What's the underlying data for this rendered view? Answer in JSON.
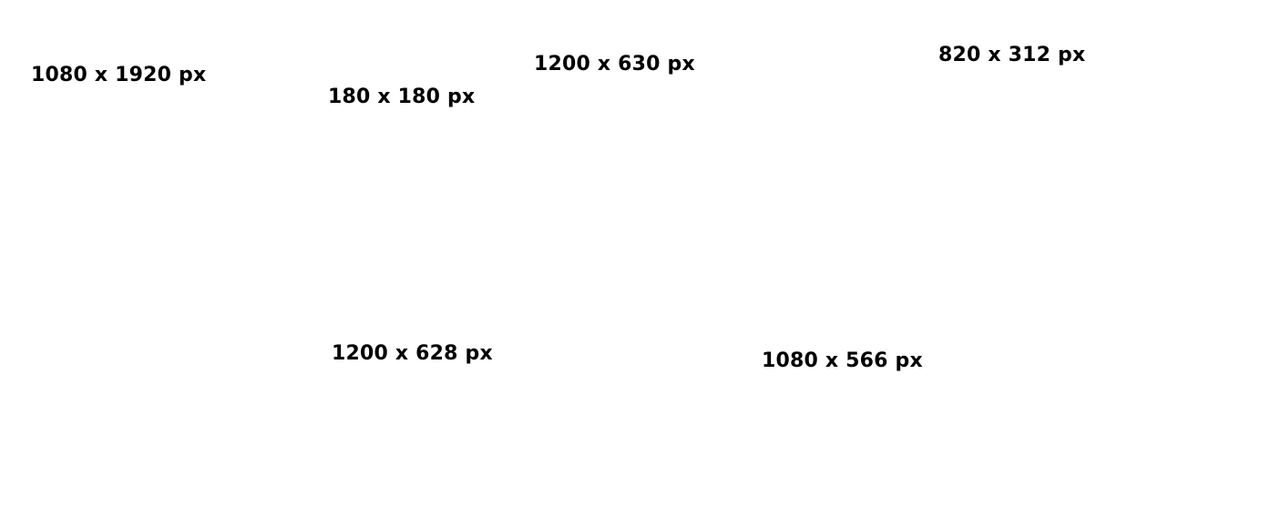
{
  "labels": {
    "story": "1080 x 1920 px",
    "profile": "180 x 180 px",
    "shared_image": "1200 x 630 px",
    "cover": "820 x 312 px",
    "link_image": "1200 x 628 px",
    "ad_image": "1080 x 566 px"
  },
  "colors": {
    "background": "#ffffff",
    "text": "#000000"
  }
}
